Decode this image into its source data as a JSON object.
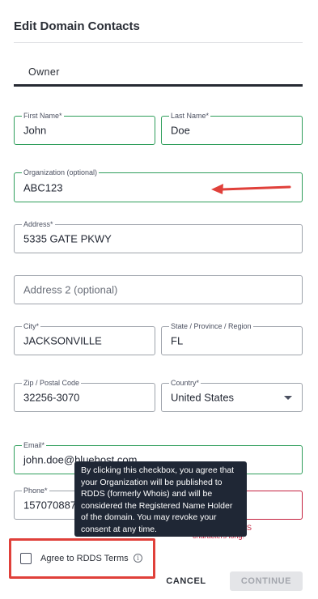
{
  "dialog": {
    "title": "Edit Domain Contacts"
  },
  "tabs": [
    {
      "label": "Owner"
    }
  ],
  "form": {
    "first_name": {
      "label": "First Name*",
      "value": "John"
    },
    "last_name": {
      "label": "Last Name*",
      "value": "Doe"
    },
    "organization": {
      "label": "Organization (optional)",
      "value": "ABC123"
    },
    "address": {
      "label": "Address*",
      "value": "5335 GATE PKWY"
    },
    "address2": {
      "placeholder": "Address 2 (optional)"
    },
    "city": {
      "label": "City*",
      "value": "JACKSONVILLE"
    },
    "state": {
      "label": "State / Province / Region",
      "value": "FL"
    },
    "zip": {
      "label": "Zip / Postal Code",
      "value": "32256-3070"
    },
    "country": {
      "label": "Country*",
      "value": "United States"
    },
    "email": {
      "label": "Email*",
      "value": "john.doe@bluehost.com"
    },
    "phone": {
      "label": "Phone*",
      "value": "15707088733"
    },
    "phone_ext": {
      "error_partial_1": "S",
      "error_partial_2": "characters long."
    }
  },
  "tooltip": {
    "text": "By clicking this checkbox, you agree that your Organization will be published to RDDS (formerly Whois) and will be considered the Registered Name Holder of the domain. You may revoke your consent at any time."
  },
  "consent": {
    "label": "Agree to RDDS Terms",
    "checked": false,
    "info_icon": "info-icon"
  },
  "actions": {
    "cancel_label": "CANCEL",
    "continue_label": "CONTINUE",
    "continue_disabled": true
  },
  "colors": {
    "valid_border": "#2f9e5b",
    "error_border": "#c4213f",
    "annotation_red": "#e0403a",
    "tooltip_bg": "#1f2735"
  }
}
